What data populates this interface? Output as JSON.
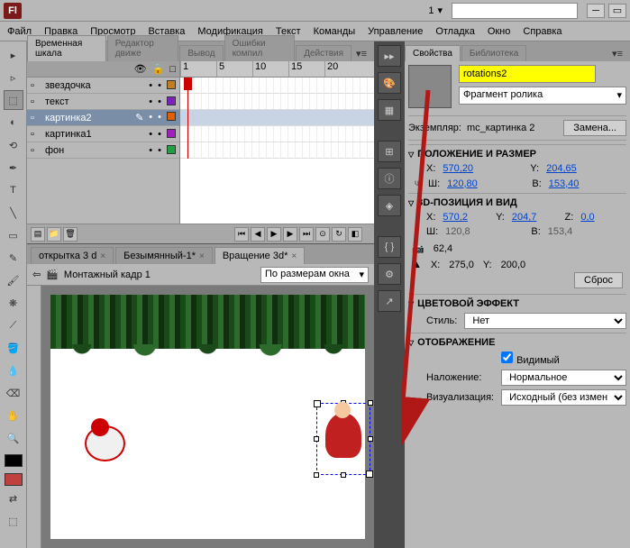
{
  "app": {
    "logo": "Fl",
    "workspace": "1"
  },
  "menu": [
    "Файл",
    "Правка",
    "Просмотр",
    "Вставка",
    "Модификация",
    "Текст",
    "Команды",
    "Управление",
    "Отладка",
    "Окно",
    "Справка"
  ],
  "panel_tabs": {
    "timeline": "Временная шкала",
    "motion": "Редактор движе",
    "output": "Вывод",
    "errors": "Ошибки компил",
    "actions": "Действия"
  },
  "ruler": [
    "1",
    "5",
    "10",
    "15",
    "20"
  ],
  "layers": [
    {
      "name": "звездочка",
      "selected": false,
      "color": "#c08020"
    },
    {
      "name": "текст",
      "selected": false,
      "color": "#8020c0"
    },
    {
      "name": "картинка2",
      "selected": true,
      "color": "#e06000"
    },
    {
      "name": "картинка1",
      "selected": false,
      "color": "#a020c0"
    },
    {
      "name": "фон",
      "selected": false,
      "color": "#20a040"
    }
  ],
  "doc_tabs": [
    {
      "label": "открытка 3 d",
      "active": false
    },
    {
      "label": "Безымянный-1*",
      "active": false
    },
    {
      "label": "Вращение 3d*",
      "active": true
    }
  ],
  "doc_bar": {
    "scene": "Монтажный кадр 1",
    "zoom": "По размерам окна"
  },
  "props": {
    "tab_props": "Свойства",
    "tab_lib": "Библиотека",
    "instance_name": "rotations2",
    "symbol_type": "Фрагмент ролика",
    "instance_label": "Экземпляр:",
    "instance_of": "mc_картинка 2",
    "swap": "Замена...",
    "section_pos": "ПОЛОЖЕНИЕ И РАЗМЕР",
    "pos": {
      "x_lbl": "X:",
      "x": "570,20",
      "y_lbl": "Y:",
      "y": "204,65",
      "w_lbl": "Ш:",
      "w": "120,80",
      "h_lbl": "В:",
      "h": "153,40"
    },
    "section_3d": "3D-ПОЗИЦИЯ И ВИД",
    "pos3d": {
      "x_lbl": "X:",
      "x": "570,2",
      "y_lbl": "Y:",
      "y": "204,7",
      "z_lbl": "Z:",
      "z": "0,0",
      "w_lbl": "Ш:",
      "w": "120,8",
      "h_lbl": "В:",
      "h": "153,4",
      "persp": "62,4",
      "vx_lbl": "X:",
      "vx": "275,0",
      "vy_lbl": "Y:",
      "vy": "200,0"
    },
    "reset": "Сброс",
    "section_color": "ЦВЕТОВОЙ ЭФФЕКТ",
    "style_lbl": "Стиль:",
    "style_val": "Нет",
    "section_display": "ОТОБРАЖЕНИЕ",
    "visible": "Видимый",
    "blend_lbl": "Наложение:",
    "blend_val": "Нормальное",
    "render_lbl": "Визуализация:",
    "render_val": "Исходный (без изменений)"
  }
}
